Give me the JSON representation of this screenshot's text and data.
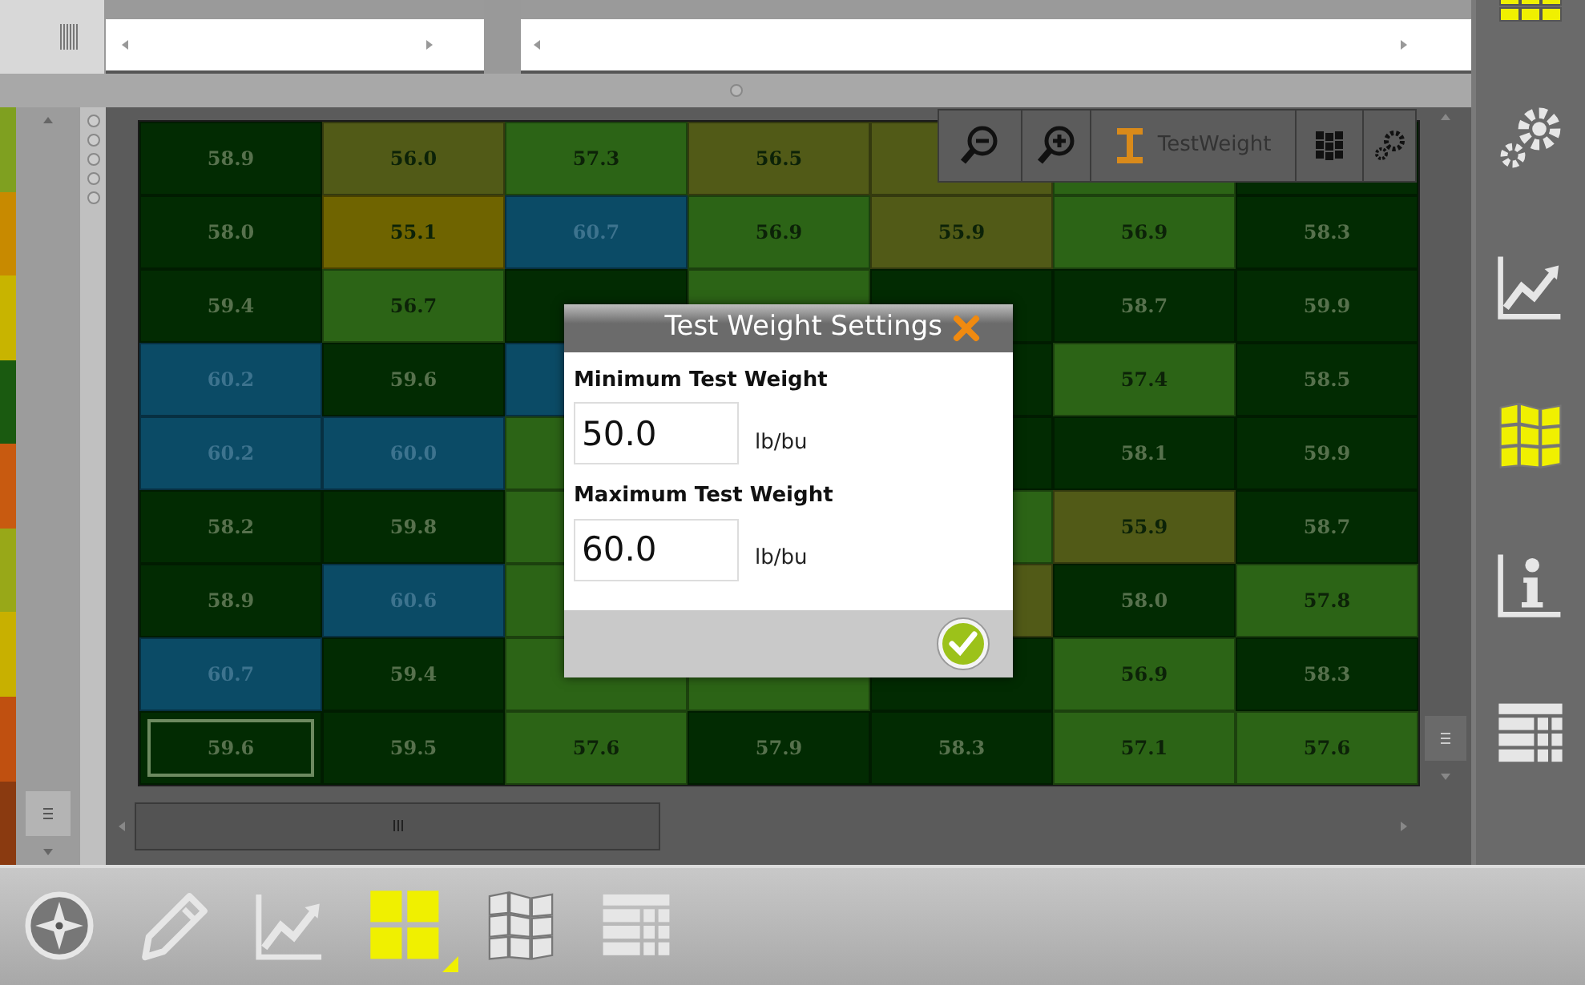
{
  "legend": [
    {
      "color": "#7fa020"
    },
    {
      "color": "#c88a00"
    },
    {
      "color": "#c8b400"
    },
    {
      "color": "#1a5a10"
    },
    {
      "color": "#c85a10"
    },
    {
      "color": "#98a818"
    },
    {
      "color": "#c8b000"
    },
    {
      "color": "#c05010"
    },
    {
      "color": "#8a3a10"
    }
  ],
  "toolbar": {
    "layer_label": "TestWeight"
  },
  "grid": {
    "rows": [
      [
        {
          "value": "58.9",
          "color": "#022b02",
          "selected": false
        },
        {
          "value": "56.0",
          "color": "#515a17",
          "selected": false
        },
        {
          "value": "57.3",
          "color": "#2c6416",
          "selected": false
        },
        {
          "value": "56.5",
          "color": "#515a17",
          "selected": false
        },
        {
          "color": "#515a17",
          "selected": false
        },
        {
          "color": "#2c6416",
          "selected": false
        },
        {
          "color": "#022b02",
          "selected": false
        }
      ],
      [
        {
          "value": "58.0",
          "color": "#022b02",
          "selected": false
        },
        {
          "value": "55.1",
          "color": "#6f6400",
          "selected": false
        },
        {
          "value": "60.7",
          "color": "#0b4b66",
          "selected": false
        },
        {
          "value": "56.9",
          "color": "#2c6416",
          "selected": false
        },
        {
          "value": "55.9",
          "color": "#515a17",
          "selected": false
        },
        {
          "value": "56.9",
          "color": "#2c6416",
          "selected": false
        },
        {
          "value": "58.3",
          "color": "#022b02",
          "selected": false
        }
      ],
      [
        {
          "value": "59.4",
          "color": "#022b02",
          "selected": false
        },
        {
          "value": "56.7",
          "color": "#2c6416",
          "selected": false
        },
        {
          "color": "#022b02",
          "selected": false
        },
        {
          "color": "#2c6416",
          "selected": false
        },
        {
          "color": "#022b02",
          "selected": false
        },
        {
          "value": "58.7",
          "color": "#022b02",
          "selected": false
        },
        {
          "value": "59.9",
          "color": "#022b02",
          "selected": false
        }
      ],
      [
        {
          "value": "60.2",
          "color": "#0b4b66",
          "selected": false
        },
        {
          "value": "59.6",
          "color": "#022b02",
          "selected": false
        },
        {
          "color": "#0b4b66",
          "selected": false
        },
        {
          "kind": "covered"
        },
        {
          "color": "#022b02",
          "selected": false
        },
        {
          "value": "57.4",
          "color": "#2c6416",
          "selected": false
        },
        {
          "value": "58.5",
          "color": "#022b02",
          "selected": false
        }
      ],
      [
        {
          "value": "60.2",
          "color": "#0b4b66",
          "selected": false
        },
        {
          "value": "60.0",
          "color": "#0b4b66",
          "selected": false
        },
        {
          "color": "#2c6416",
          "selected": false
        },
        {
          "kind": "covered"
        },
        {
          "color": "#022b02",
          "selected": false
        },
        {
          "value": "58.1",
          "color": "#022b02",
          "selected": false
        },
        {
          "value": "59.9",
          "color": "#022b02",
          "selected": false
        }
      ],
      [
        {
          "value": "58.2",
          "color": "#022b02",
          "selected": false
        },
        {
          "value": "59.8",
          "color": "#022b02",
          "selected": false
        },
        {
          "color": "#2c6416",
          "selected": false
        },
        {
          "kind": "covered"
        },
        {
          "color": "#2c6416",
          "selected": false
        },
        {
          "value": "55.9",
          "color": "#515a17",
          "selected": false
        },
        {
          "value": "58.7",
          "color": "#022b02",
          "selected": false
        }
      ],
      [
        {
          "value": "58.9",
          "color": "#022b02",
          "selected": false
        },
        {
          "value": "60.6",
          "color": "#0b4b66",
          "selected": false
        },
        {
          "color": "#2c6416",
          "selected": false
        },
        {
          "kind": "covered"
        },
        {
          "color": "#515a17",
          "selected": false
        },
        {
          "value": "58.0",
          "color": "#022b02",
          "selected": false
        },
        {
          "value": "57.8",
          "color": "#2c6416",
          "selected": false
        }
      ],
      [
        {
          "value": "60.7",
          "color": "#0b4b66",
          "selected": false
        },
        {
          "value": "59.4",
          "color": "#022b02",
          "selected": false
        },
        {
          "color": "#2c6416",
          "selected": false
        },
        {
          "color": "#2c6416",
          "selected": false
        },
        {
          "color": "#022b02",
          "selected": false
        },
        {
          "value": "56.9",
          "color": "#2c6416",
          "selected": false
        },
        {
          "value": "58.3",
          "color": "#022b02",
          "selected": false
        }
      ],
      [
        {
          "value": "59.6",
          "color": "#022b02",
          "selected": true
        },
        {
          "value": "59.5",
          "color": "#022b02",
          "selected": false
        },
        {
          "value": "57.6",
          "color": "#2c6416",
          "selected": false
        },
        {
          "value": "57.9",
          "color": "#022b02",
          "selected": false
        },
        {
          "value": "58.3",
          "color": "#022b02",
          "selected": false
        },
        {
          "value": "57.1",
          "color": "#2c6416",
          "selected": false
        },
        {
          "value": "57.6",
          "color": "#2c6416",
          "selected": false
        }
      ]
    ]
  },
  "dialog": {
    "title": "Test Weight Settings",
    "fields": [
      {
        "label": "Minimum Test Weight",
        "value": "50.0",
        "unit": "lb/bu"
      },
      {
        "label": "Maximum Test Weight",
        "value": "60.0",
        "unit": "lb/bu"
      }
    ]
  },
  "sidebar": {
    "items": [
      {
        "kind": "gear",
        "selected": false
      },
      {
        "kind": "chart",
        "selected": false
      },
      {
        "kind": "map",
        "selected": true
      },
      {
        "kind": "info",
        "selected": false
      },
      {
        "kind": "table",
        "selected": false
      }
    ]
  },
  "bottom_bar": {
    "items": [
      {
        "kind": "compass",
        "selected": false
      },
      {
        "kind": "pencil",
        "selected": false
      },
      {
        "kind": "chart",
        "selected": false
      },
      {
        "kind": "tiles",
        "selected": true
      },
      {
        "kind": "map",
        "selected": false
      },
      {
        "kind": "table",
        "selected": false
      }
    ]
  }
}
